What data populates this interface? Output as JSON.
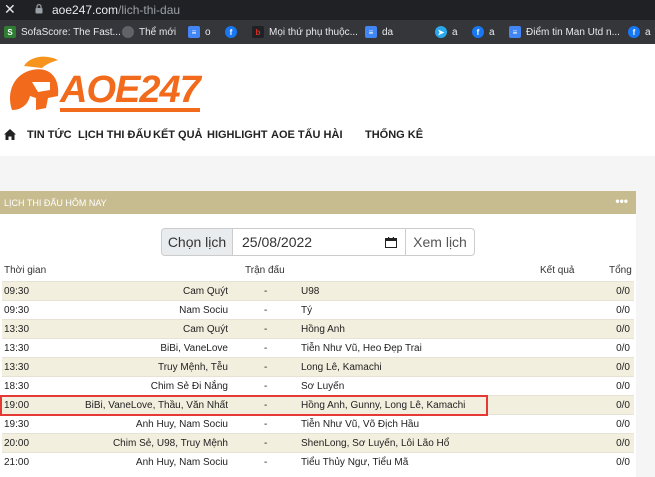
{
  "browser": {
    "url_domain": "aoe247.com",
    "url_path": "/lich-thi-dau",
    "bookmarks": [
      {
        "label": "SofaScore: The Fast...",
        "icon": "sofascore-icon"
      },
      {
        "label": "Thể mới",
        "icon": "globe-icon"
      },
      {
        "label": "o",
        "icon": "doc-icon"
      },
      {
        "label": "",
        "icon": "facebook-icon"
      },
      {
        "label": "Mọi thứ phụ thuộc...",
        "icon": "b-icon"
      },
      {
        "label": "da",
        "icon": "doc-icon"
      },
      {
        "label": "a",
        "icon": "telegram-icon"
      },
      {
        "label": "a",
        "icon": "facebook-icon"
      },
      {
        "label": "Điểm tin Man Utd n...",
        "icon": "doc-icon"
      },
      {
        "label": "a",
        "icon": "facebook-icon"
      }
    ]
  },
  "site": {
    "logo_text": "AOE247",
    "nav": [
      "TIN TỨC",
      "LỊCH THI ĐẤU",
      "KẾT QUẢ",
      "HIGHLIGHT",
      "AOE TẤU HÀI",
      "THỐNG KÊ"
    ]
  },
  "panel": {
    "title": "LỊCH THI ĐẤU HÔM NAY",
    "menu_glyph": "•••",
    "choose_label": "Chọn lịch",
    "date_value": "25/08/2022",
    "view_label": "Xem lịch"
  },
  "table": {
    "headers": {
      "time": "Thời gian",
      "match": "Trận đấu",
      "result": "Kết quả",
      "total": "Tổng"
    },
    "rows": [
      {
        "time": "09:30",
        "home": "Cam Quýt",
        "vs": "-",
        "away": "U98",
        "score": "0/0"
      },
      {
        "time": "09:30",
        "home": "Nam Sociu",
        "vs": "-",
        "away": "Tý",
        "score": "0/0"
      },
      {
        "time": "13:30",
        "home": "Cam Quýt",
        "vs": "-",
        "away": "Hồng Anh",
        "score": "0/0"
      },
      {
        "time": "13:30",
        "home": "BiBi, VaneLove",
        "vs": "-",
        "away": "Tiễn Như Vũ, Heo Đẹp Trai",
        "score": "0/0"
      },
      {
        "time": "13:30",
        "home": "Truy Mệnh, Tễu",
        "vs": "-",
        "away": "Long Lê, Kamachi",
        "score": "0/0"
      },
      {
        "time": "18:30",
        "home": "Chim Sẻ Đi Nắng",
        "vs": "-",
        "away": "Sơ Luyến",
        "score": "0/0"
      },
      {
        "time": "19:00",
        "home": "BiBi, VaneLove, Thầu, Văn Nhất",
        "vs": "-",
        "away": "Hồng Anh, Gunny, Long Lê, Kamachi",
        "score": "0/0"
      },
      {
        "time": "19:30",
        "home": "Anh Huy, Nam Sociu",
        "vs": "-",
        "away": "Tiễn Như Vũ, Võ Địch Hầu",
        "score": "0/0"
      },
      {
        "time": "20:00",
        "home": "Chim Sẻ, U98, Truy Mệnh",
        "vs": "-",
        "away": "ShenLong, Sơ Luyến, Lôi Lão Hổ",
        "score": "0/0"
      },
      {
        "time": "21:00",
        "home": "Anh Huy, Nam Sociu",
        "vs": "-",
        "away": "Tiểu Thủy Ngư, Tiểu Mã",
        "score": "0/0"
      }
    ]
  }
}
